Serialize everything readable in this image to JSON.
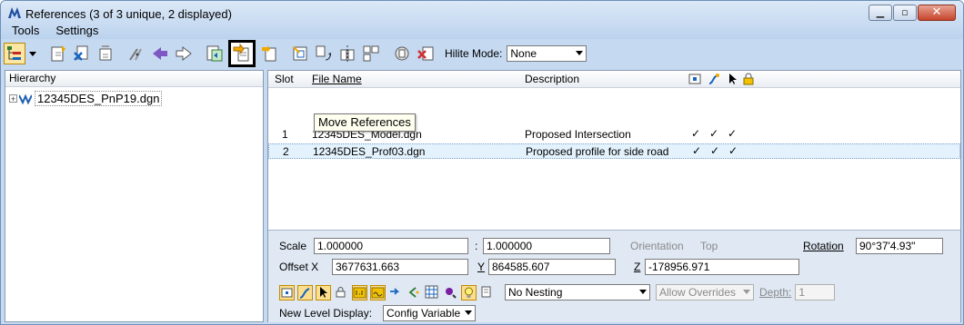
{
  "window": {
    "title": "References (3 of 3 unique, 2 displayed)",
    "minimize_glyph": "▁",
    "maximize_glyph": "▫",
    "close_glyph": "✕"
  },
  "menu": {
    "tools_label": "Tools",
    "settings_label": "Settings"
  },
  "toolbar": {
    "hilite_label": "Hilite Mode:",
    "hilite_value": "None",
    "tools": [
      "hierarchy-icon",
      "attach-reference-icon",
      "detach-reference-icon",
      "reload-reference-icon",
      "clip-boundary-icon",
      "clip-mask-icon",
      "delete-clip-icon",
      "exchange-icon",
      "move-references-icon",
      "copy-reference-icon",
      "scale-reference-icon",
      "rotate-reference-icon",
      "mirror-icon",
      "mirror-vertical-icon",
      "reference-settings-icon",
      "detach-icon"
    ]
  },
  "tooltip": {
    "text": "Move References"
  },
  "tree": {
    "header": "Hierarchy",
    "root_label": "12345DES_PnP19.dgn",
    "expander": "+"
  },
  "grid": {
    "headers": {
      "slot": "Slot",
      "file_name": "File Name",
      "description": "Description"
    },
    "rows": [
      {
        "slot": "1",
        "file_name": "12345DES_Model.dgn",
        "description": "Proposed Intersection",
        "display": "✓",
        "snap": "✓",
        "locate": "✓"
      },
      {
        "slot": "2",
        "file_name": "12345DES_Prof03.dgn",
        "description": "Proposed profile for side road",
        "display": "✓",
        "snap": "✓",
        "locate": "✓"
      }
    ]
  },
  "props": {
    "scale_label": "Scale",
    "scale_value_1": "1.000000",
    "scale_separator": ":",
    "scale_value_2": "1.000000",
    "orientation_label": "Orientation",
    "orientation_value": "Top",
    "rotation_label": "Rotation",
    "rotation_value": "90°37'4.93\"",
    "offset_x_label": "Offset X",
    "offset_x_value": "3677631.663",
    "y_label": "Y",
    "y_value": "864585.607",
    "z_label": "Z",
    "z_value": "-178956.971",
    "nesting_value": "No Nesting",
    "overrides_value": "Allow Overrides",
    "depth_label": "Depth:",
    "depth_value": "1",
    "new_level_label": "New Level Display:",
    "new_level_value": "Config Variable"
  },
  "colors": {
    "accent": "#c5d9f1",
    "selected_row": "#e3f2fc",
    "tooltip_bg": "#fffff0"
  }
}
